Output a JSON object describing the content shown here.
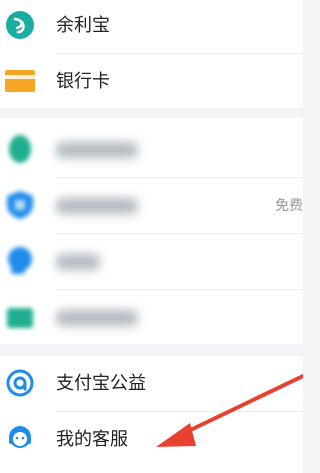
{
  "menu": {
    "group1": {
      "yuebao": {
        "label": "余利宝",
        "icon": "yulibao-icon",
        "color": "#1aaea3"
      },
      "bank_card": {
        "label": "银行卡",
        "icon": "bank-card-icon",
        "color": "#f5a623"
      }
    },
    "group2": {
      "item1": {
        "icon": "blurred-green-icon",
        "color": "#1fae8f"
      },
      "item2": {
        "icon": "blurred-shield-icon",
        "color": "#1f8ceb",
        "trailing": "免费"
      },
      "item3": {
        "icon": "blurred-blue-icon",
        "color": "#1f8ceb"
      },
      "item4": {
        "icon": "blurred-teal-icon",
        "color": "#1fae8f"
      }
    },
    "group3": {
      "charity": {
        "label": "支付宝公益",
        "icon": "charity-icon",
        "color": "#1f8ceb"
      },
      "customer_service": {
        "label": "我的客服",
        "icon": "customer-service-icon",
        "color": "#1f8ceb"
      }
    }
  },
  "annotation": {
    "color": "#e8412f"
  }
}
